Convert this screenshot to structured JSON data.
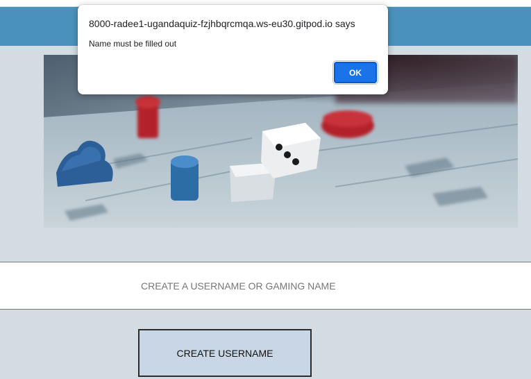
{
  "dialog": {
    "title": "8000-radee1-ugandaquiz-fzjhbqrcmqa.ws-eu30.gitpod.io says",
    "message": "Name must be filled out",
    "ok_label": "OK"
  },
  "form": {
    "username_placeholder": "CREATE A USERNAME OR GAMING NAME",
    "username_value": "",
    "create_button_label": "CREATE USERNAME"
  },
  "colors": {
    "page_background": "#d4dce3",
    "header_bar": "#4a92bd",
    "create_button": "#c8d6e5",
    "ok_button": "#1a73e8"
  }
}
